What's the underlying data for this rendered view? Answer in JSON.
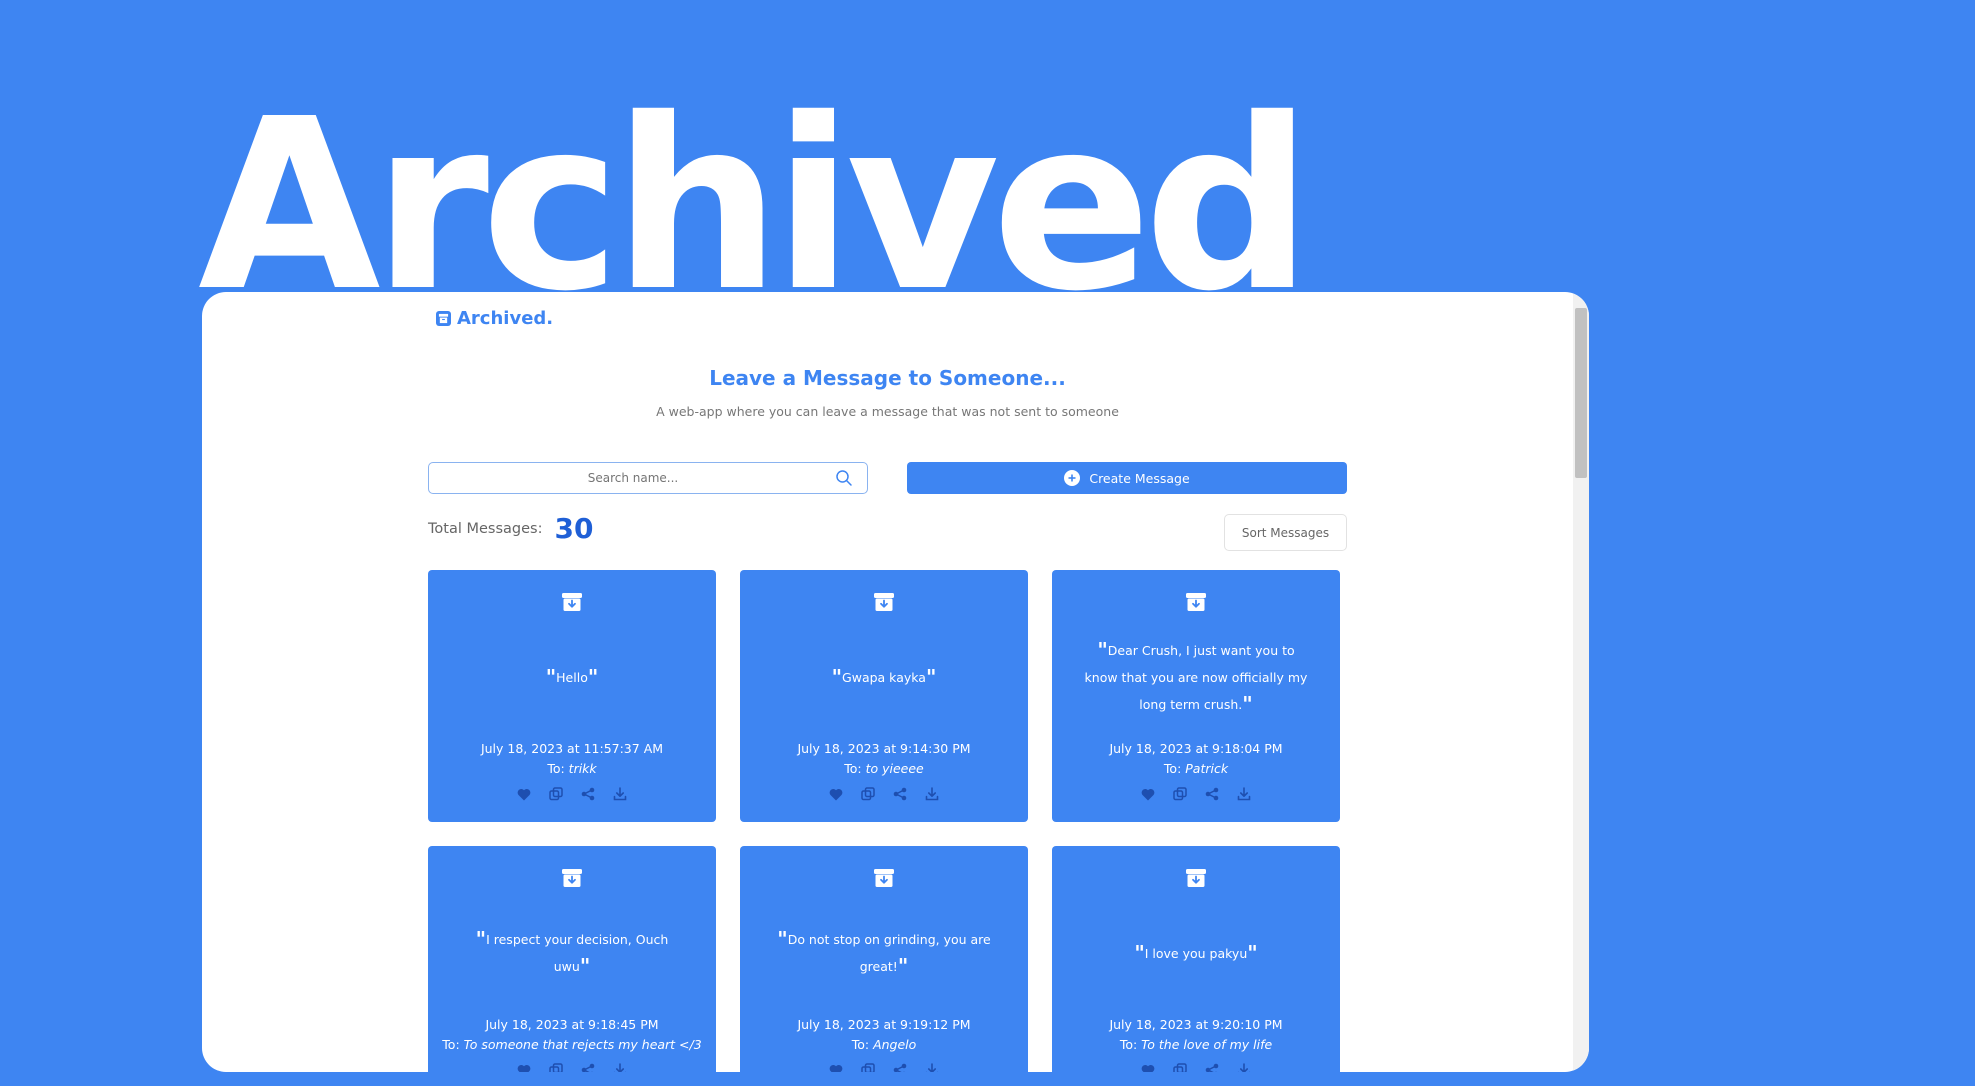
{
  "hero": {
    "title": "Archived"
  },
  "app": {
    "brand": "Archived."
  },
  "main": {
    "headline": "Leave a Message to Someone...",
    "subtitle": "A web-app where you can leave a message that was not sent to someone"
  },
  "search": {
    "placeholder": "Search name..."
  },
  "create_button": {
    "label": "Create Message"
  },
  "stats": {
    "total_label": "Total Messages:",
    "total_count": "30"
  },
  "sort_button": {
    "label": "Sort Messages"
  },
  "cards": [
    {
      "message": "Hello",
      "date": "July 18, 2023 at 11:57:37 AM",
      "to_prefix": "To:",
      "to": "trikk"
    },
    {
      "message": "Gwapa kayka",
      "date": "July 18, 2023 at 9:14:30 PM",
      "to_prefix": "To:",
      "to": "to yieeee"
    },
    {
      "message": "Dear Crush, I just want you to know that you are now officially my long term crush.",
      "date": "July 18, 2023 at 9:18:04 PM",
      "to_prefix": "To:",
      "to": "Patrick"
    },
    {
      "message": "I respect your decision, Ouch uwu",
      "date": "July 18, 2023 at 9:18:45 PM",
      "to_prefix": "To:",
      "to": "To someone that rejects my heart </3"
    },
    {
      "message": "Do not stop on grinding, you are great!",
      "date": "July 18, 2023 at 9:19:12 PM",
      "to_prefix": "To:",
      "to": "Angelo"
    },
    {
      "message": "I love you pakyu",
      "date": "July 18, 2023 at 9:20:10 PM",
      "to_prefix": "To:",
      "to": "To the love of my life"
    }
  ],
  "icons": {
    "brand": "archive-box-icon",
    "card_top": "archive-download-icon",
    "actions": [
      "heart-icon",
      "copy-icon",
      "share-icon",
      "download-icon"
    ]
  },
  "colors": {
    "background": "#3e85f2",
    "accent": "#3e85f2",
    "count": "#1f5fd6",
    "card_icons": "#1e4fb0"
  }
}
